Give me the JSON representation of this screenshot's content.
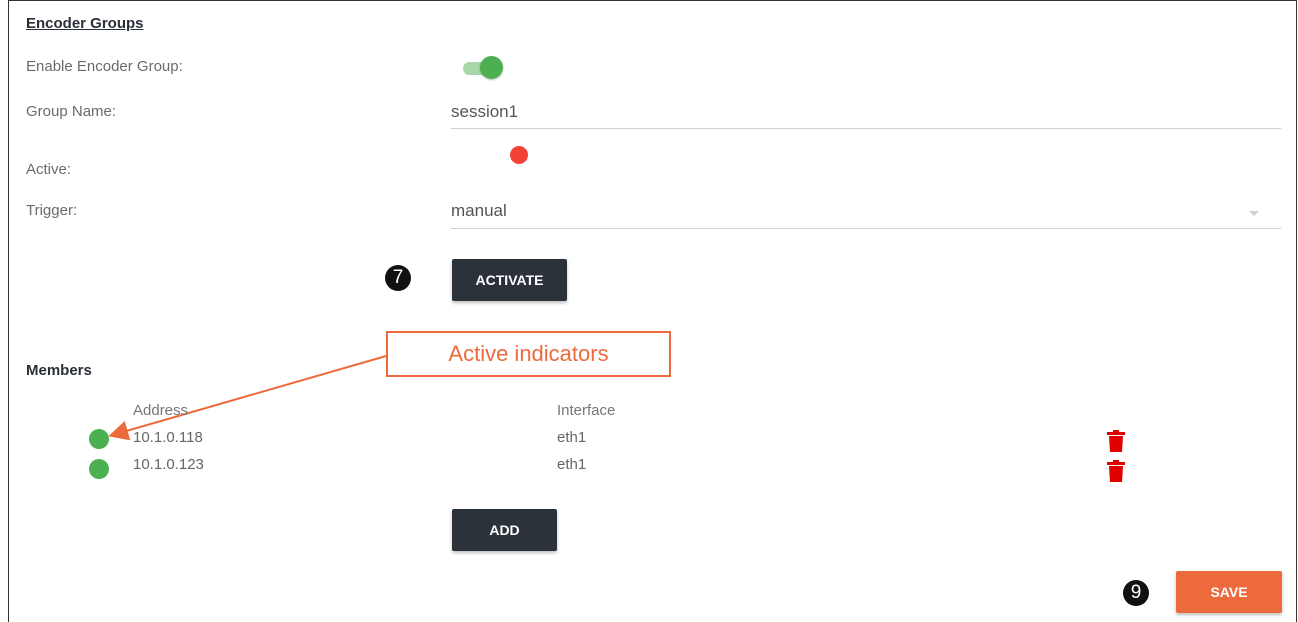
{
  "section_title": "Encoder Groups",
  "form": {
    "enable_label": "Enable Encoder Group:",
    "enable_on": true,
    "group_name_label": "Group Name:",
    "group_name_value": "session1",
    "active_label": "Active:",
    "active_status": "inactive",
    "trigger_label": "Trigger:",
    "trigger_value": "manual"
  },
  "buttons": {
    "activate": "ACTIVATE",
    "add": "ADD",
    "save": "SAVE"
  },
  "badges": {
    "activate_step": "7",
    "save_step": "9"
  },
  "members": {
    "title": "Members",
    "columns": {
      "address": "Address",
      "interface": "Interface"
    },
    "rows": [
      {
        "address": "10.1.0.118",
        "interface": "eth1",
        "active": true
      },
      {
        "address": "10.1.0.123",
        "interface": "eth1",
        "active": true
      }
    ]
  },
  "annotation": {
    "callout_text": "Active indicators"
  },
  "colors": {
    "accent_orange": "#ec6a3c",
    "active_green": "#4caf50",
    "inactive_red": "#f44336",
    "delete_red": "#e00000",
    "button_dark": "#2b323a"
  },
  "icons": {
    "delete": "trash-icon",
    "dropdown": "caret-down-icon"
  }
}
